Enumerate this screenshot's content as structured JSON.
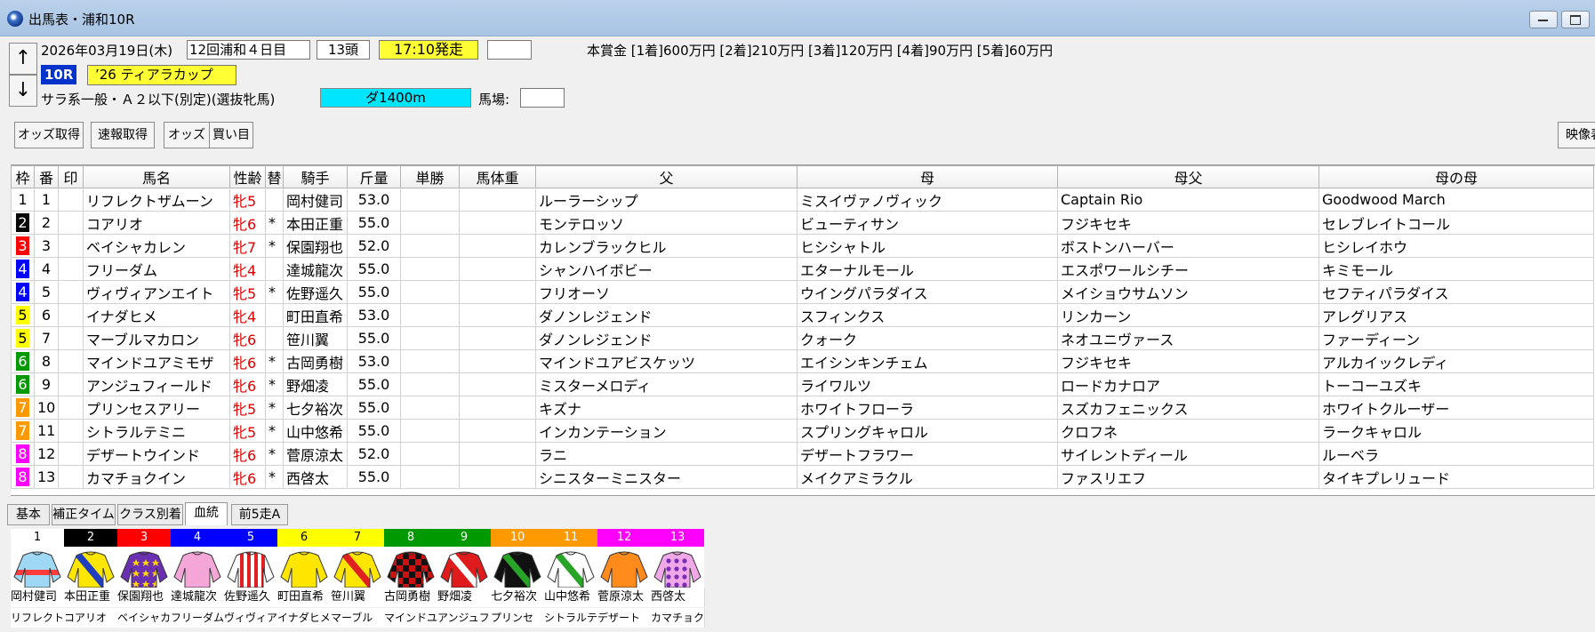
{
  "window": {
    "title": "出馬表・浦和10R"
  },
  "race": {
    "date": "2026年03月19日(木)",
    "meeting": "12回浦和４日目",
    "field_size": "13頭",
    "post_time": "17:10発走",
    "prize": "本賞金 [1着]600万円 [2着]210万円 [3着]120万円 [4着]90万円 [5着]60万円",
    "race_no": "10R",
    "race_name": "’26 ティアラカップ",
    "conditions": "サラ系一般・Ａ２以下(別定)(選抜牝馬)",
    "course": "ダ1400m",
    "track_label": "馬場:"
  },
  "nav": {
    "up": "↑",
    "down": "↓"
  },
  "toolbar": {
    "odds_fetch": "オッズ取得",
    "result_fetch": "速報取得",
    "odds": "オッズ",
    "bets": "買い目",
    "video": "映像表"
  },
  "columns": [
    "枠",
    "番",
    "印",
    "馬名",
    "性齢",
    "替",
    "騎手",
    "斤量",
    "単勝",
    "馬体重",
    "父",
    "母",
    "母父",
    "母の母"
  ],
  "waku_colors": {
    "1": {
      "bg": "#ffffff",
      "fg": "#000000"
    },
    "2": {
      "bg": "#000000",
      "fg": "#ffffff"
    },
    "3": {
      "bg": "#ff0000",
      "fg": "#ffffff"
    },
    "4": {
      "bg": "#0000ff",
      "fg": "#ffffff"
    },
    "5": {
      "bg": "#ffff00",
      "fg": "#000000"
    },
    "6": {
      "bg": "#009900",
      "fg": "#ffffff"
    },
    "7": {
      "bg": "#ff9900",
      "fg": "#ffffff"
    },
    "8": {
      "bg": "#ff00ff",
      "fg": "#ffffff"
    }
  },
  "entries": [
    {
      "waku": "1",
      "num": "1",
      "horse": "リフレクトザムーン",
      "sex": "牝5",
      "change": "",
      "jockey": "岡村健司",
      "weight": "53.0",
      "sire": "ルーラーシップ",
      "dam": "ミスイヴァノヴィック",
      "damsire": "Captain Rio",
      "granddam": "Goodwood March"
    },
    {
      "waku": "2",
      "num": "2",
      "horse": "コアリオ",
      "sex": "牝6",
      "change": "*",
      "jockey": "本田正重",
      "weight": "55.0",
      "sire": "モンテロッソ",
      "dam": "ビューティサン",
      "damsire": "フジキセキ",
      "granddam": "セレブレイトコール"
    },
    {
      "waku": "3",
      "num": "3",
      "horse": "ベイシャカレン",
      "sex": "牝7",
      "change": "*",
      "jockey": "保園翔也",
      "weight": "52.0",
      "sire": "カレンブラックヒル",
      "dam": "ヒシシャトル",
      "damsire": "ボストンハーバー",
      "granddam": "ヒシレイホウ"
    },
    {
      "waku": "4",
      "num": "4",
      "horse": "フリーダム",
      "sex": "牝4",
      "change": "",
      "jockey": "達城龍次",
      "weight": "55.0",
      "sire": "シャンハイボビー",
      "dam": "エターナルモール",
      "damsire": "エスポワールシチー",
      "granddam": "キミモール"
    },
    {
      "waku": "4",
      "num": "5",
      "horse": "ヴィヴィアンエイト",
      "sex": "牝5",
      "change": "*",
      "jockey": "佐野遥久",
      "weight": "55.0",
      "sire": "フリオーソ",
      "dam": "ウイングパラダイス",
      "damsire": "メイショウサムソン",
      "granddam": "セフティパラダイス"
    },
    {
      "waku": "5",
      "num": "6",
      "horse": "イナダヒメ",
      "sex": "牝4",
      "change": "",
      "jockey": "町田直希",
      "weight": "53.0",
      "sire": "ダノンレジェンド",
      "dam": "スフィンクス",
      "damsire": "リンカーン",
      "granddam": "アレグリアス"
    },
    {
      "waku": "5",
      "num": "7",
      "horse": "マーブルマカロン",
      "sex": "牝6",
      "change": "",
      "jockey": "笹川翼",
      "weight": "55.0",
      "sire": "ダノンレジェンド",
      "dam": "クォーク",
      "damsire": "ネオユニヴァース",
      "granddam": "ファーディーン"
    },
    {
      "waku": "6",
      "num": "8",
      "horse": "マインドユアミモザ",
      "sex": "牝6",
      "change": "*",
      "jockey": "古岡勇樹",
      "weight": "53.0",
      "sire": "マインドユアビスケッツ",
      "dam": "エイシンキンチェム",
      "damsire": "フジキセキ",
      "granddam": "アルカイックレディ"
    },
    {
      "waku": "6",
      "num": "9",
      "horse": "アンジュフィールド",
      "sex": "牝6",
      "change": "*",
      "jockey": "野畑凌",
      "weight": "55.0",
      "sire": "ミスターメロディ",
      "dam": "ライワルツ",
      "damsire": "ロードカナロア",
      "granddam": "トーコーユズキ"
    },
    {
      "waku": "7",
      "num": "10",
      "horse": "プリンセスアリー",
      "sex": "牝5",
      "change": "*",
      "jockey": "七夕裕次",
      "weight": "55.0",
      "sire": "キズナ",
      "dam": "ホワイトフローラ",
      "damsire": "スズカフェニックス",
      "granddam": "ホワイトクルーザー"
    },
    {
      "waku": "7",
      "num": "11",
      "horse": "シトラルテミニ",
      "sex": "牝5",
      "change": "*",
      "jockey": "山中悠希",
      "weight": "55.0",
      "sire": "インカンテーション",
      "dam": "スプリングキャロル",
      "damsire": "クロフネ",
      "granddam": "ラークキャロル"
    },
    {
      "waku": "8",
      "num": "12",
      "horse": "デザートウインド",
      "sex": "牝6",
      "change": "*",
      "jockey": "菅原涼太",
      "weight": "52.0",
      "sire": "ラニ",
      "dam": "デザートフラワー",
      "damsire": "サイレントディール",
      "granddam": "ルーベラ"
    },
    {
      "waku": "8",
      "num": "13",
      "horse": "カマチョクイン",
      "sex": "牝6",
      "change": "*",
      "jockey": "西啓太",
      "weight": "55.0",
      "sire": "シニスターミニスター",
      "dam": "メイクアミラクル",
      "damsire": "ファスリエフ",
      "granddam": "タイキプレリュード"
    }
  ],
  "tabs": [
    "基本",
    "補正タイム",
    "クラス別着",
    "血統",
    "前5走A"
  ],
  "active_tab": "血統",
  "silks": [
    {
      "num": "1",
      "waku": "1",
      "jockey": "岡村健司",
      "horse": "リフレクト",
      "body": "#9fd8f5",
      "pattern": "band",
      "accent": "#ff3b3b"
    },
    {
      "num": "2",
      "waku": "2",
      "jockey": "本田正重",
      "horse": "コアリオ",
      "body": "#ffe600",
      "pattern": "sash",
      "accent": "#1f3fbf"
    },
    {
      "num": "3",
      "waku": "3",
      "jockey": "保園翔也",
      "horse": "ベイシャカ",
      "body": "#6a2fb3",
      "pattern": "stars",
      "accent": "#ffd400"
    },
    {
      "num": "4",
      "waku": "4",
      "jockey": "達城龍次",
      "horse": "フリーダム",
      "body": "#f4a6d8",
      "pattern": "plain",
      "accent": "#111111"
    },
    {
      "num": "5",
      "waku": "4",
      "jockey": "佐野遥久",
      "horse": "ヴィヴィア",
      "body": "#ffffff",
      "pattern": "stripes",
      "accent": "#e02020"
    },
    {
      "num": "6",
      "waku": "5",
      "jockey": "町田直希",
      "horse": "イナダヒメ",
      "body": "#ffe600",
      "pattern": "plain",
      "accent": "#111111"
    },
    {
      "num": "7",
      "waku": "5",
      "jockey": "笹川翼",
      "horse": "マーブル",
      "body": "#ffe600",
      "pattern": "sash",
      "accent": "#e02020"
    },
    {
      "num": "8",
      "waku": "6",
      "jockey": "古岡勇樹",
      "horse": "マインドユ",
      "body": "#cc1111",
      "pattern": "checks",
      "accent": "#111111"
    },
    {
      "num": "9",
      "waku": "6",
      "jockey": "野畑凌",
      "horse": "アンジュフ",
      "body": "#e01b1b",
      "pattern": "sash",
      "accent": "#ffffff"
    },
    {
      "num": "10",
      "waku": "7",
      "jockey": "七夕裕次",
      "horse": "プリンセ",
      "body": "#111111",
      "pattern": "sash",
      "accent": "#28a428"
    },
    {
      "num": "11",
      "waku": "7",
      "jockey": "山中悠希",
      "horse": "シトラルテ",
      "body": "#ffffff",
      "pattern": "sash",
      "accent": "#28a428"
    },
    {
      "num": "12",
      "waku": "8",
      "jockey": "菅原涼太",
      "horse": "デザート",
      "body": "#ff8c1a",
      "pattern": "plain",
      "accent": "#111111"
    },
    {
      "num": "13",
      "waku": "8",
      "jockey": "西啓太",
      "horse": "カマチョク",
      "body": "#f0a8e8",
      "pattern": "dots",
      "accent": "#7a2fb3"
    }
  ]
}
